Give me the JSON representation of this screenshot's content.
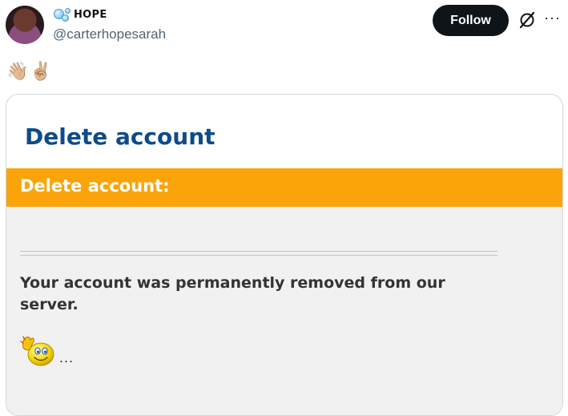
{
  "post": {
    "display_name": "HOPE",
    "name_prefix_icon": "bubbles-icon",
    "handle": "@carterhopesarah",
    "follow_label": "Follow",
    "emojis": "👋🏼✌🏼"
  },
  "card": {
    "title": "Delete account",
    "section_header": "Delete account:",
    "message": "Your account was permanently removed from our server.",
    "trailing": "...",
    "colors": {
      "title": "#0d4b8a",
      "header_bar": "#fba40a",
      "panel": "#f1f1f1"
    }
  }
}
